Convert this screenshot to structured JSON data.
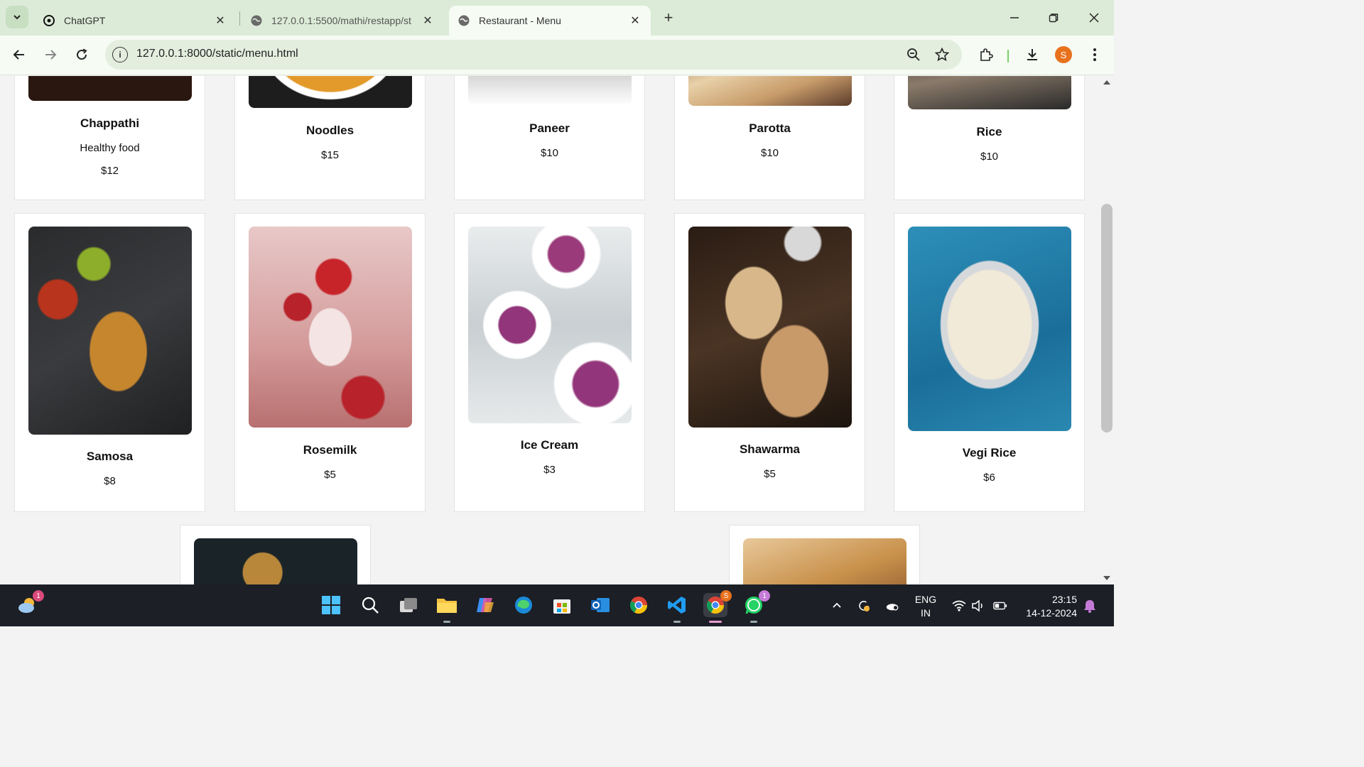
{
  "browser": {
    "tabs": [
      {
        "title": "ChatGPT",
        "favicon": "chatgpt-icon",
        "active": false
      },
      {
        "title": "127.0.0.1:5500/mathi/restapp/st",
        "favicon": "globe-icon",
        "active": false
      },
      {
        "title": "Restaurant - Menu",
        "favicon": "globe-icon",
        "active": true
      }
    ],
    "url": "127.0.0.1:8000/static/menu.html",
    "profile_initial": "S"
  },
  "menu": {
    "row1": [
      {
        "name": "Chappathi",
        "desc": "Healthy food",
        "price": "$12"
      },
      {
        "name": "Noodles",
        "desc": "",
        "price": "$15"
      },
      {
        "name": "Paneer",
        "desc": "",
        "price": "$10"
      },
      {
        "name": "Parotta",
        "desc": "",
        "price": "$10"
      },
      {
        "name": "Rice",
        "desc": "",
        "price": "$10"
      }
    ],
    "row2": [
      {
        "name": "Samosa",
        "price": "$8"
      },
      {
        "name": "Rosemilk",
        "price": "$5"
      },
      {
        "name": "Ice Cream",
        "price": "$3"
      },
      {
        "name": "Shawarma",
        "price": "$5"
      },
      {
        "name": "Vegi Rice",
        "price": "$6"
      }
    ]
  },
  "taskbar": {
    "weather_badge": "1",
    "chrome_badge": "S",
    "whatsapp_badge": "1",
    "language_line1": "ENG",
    "language_line2": "IN",
    "time": "23:15",
    "date": "14-12-2024"
  },
  "colors": {
    "tab_bar": "#dcebd7",
    "toolbar": "#f6fbf4",
    "page_bg": "#f3f3f3",
    "taskbar": "#1c1f26",
    "profile": "#e8711c"
  }
}
